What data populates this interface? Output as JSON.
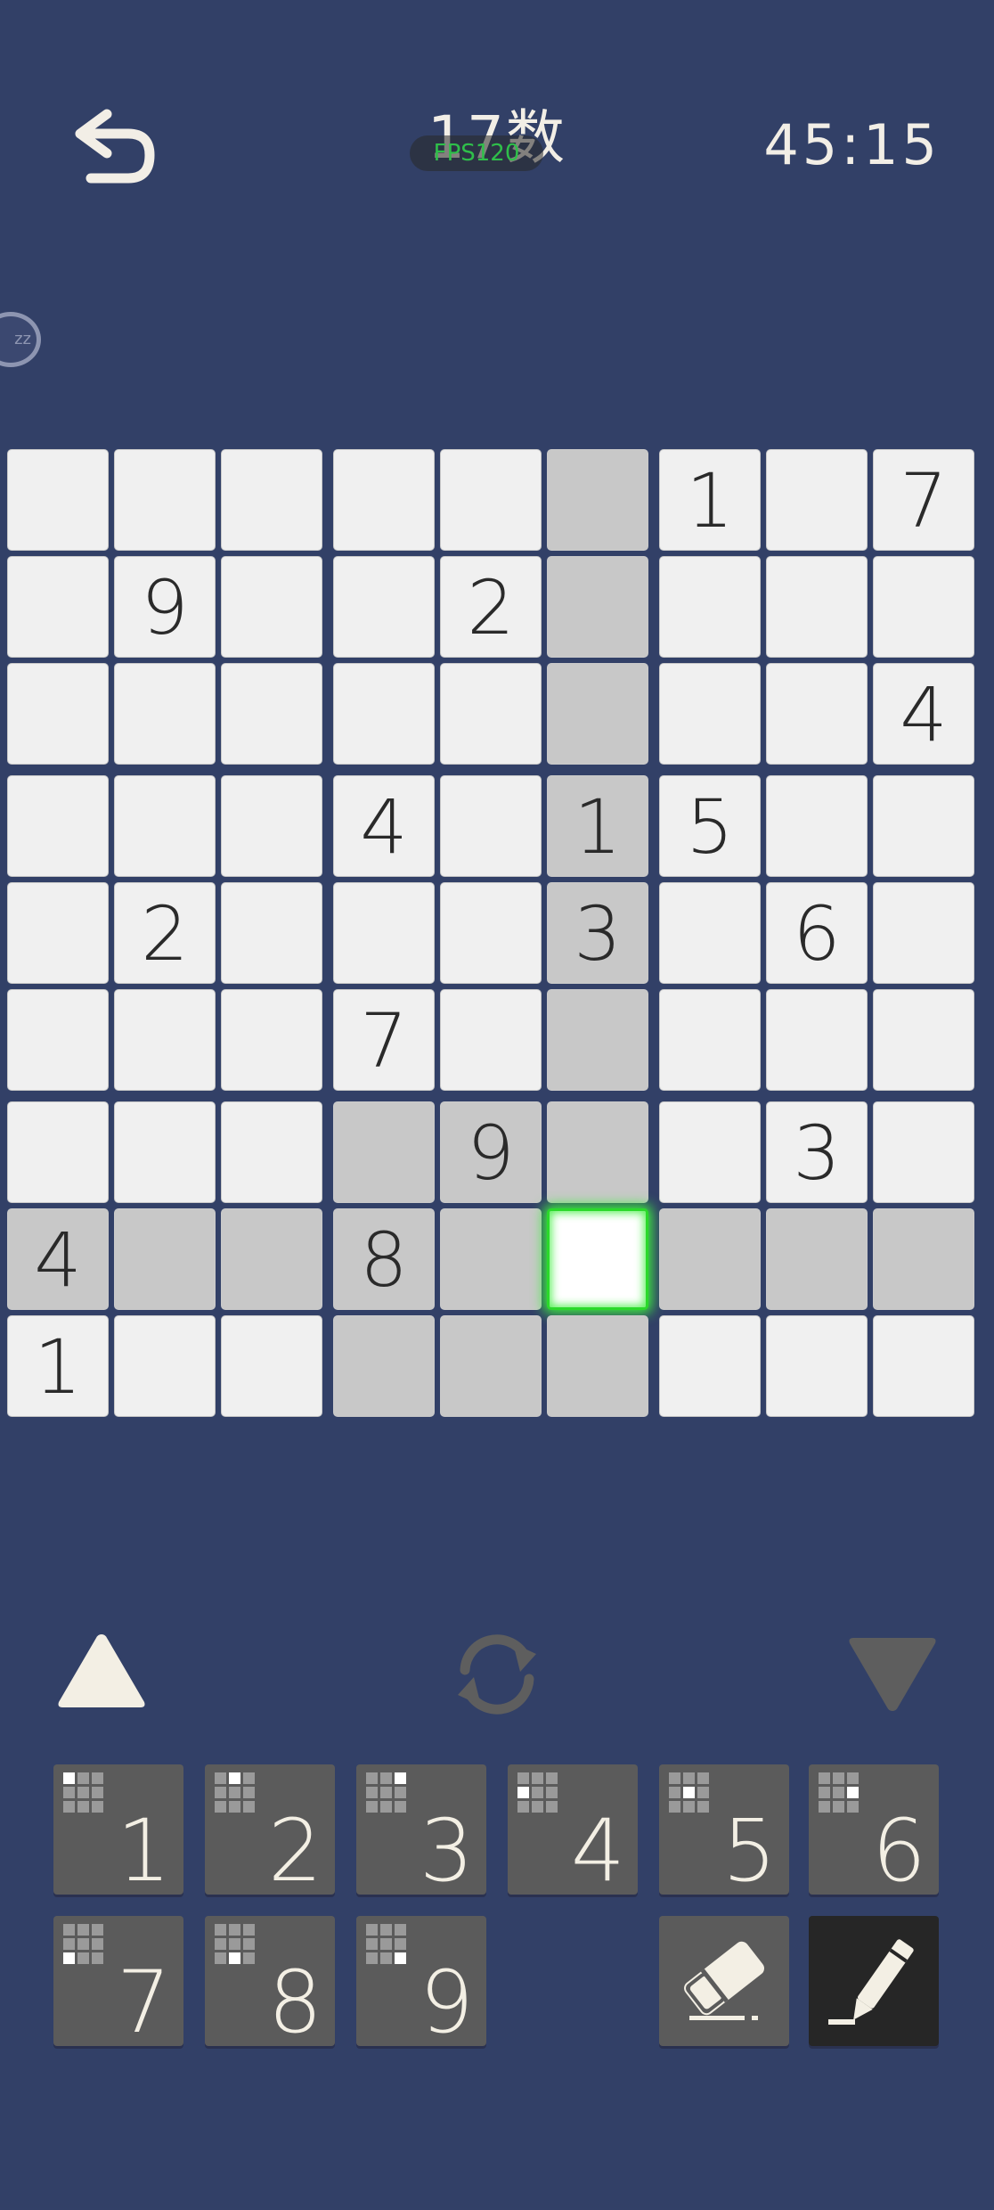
{
  "header": {
    "title": "17数",
    "fps": "FPS120",
    "timer": "45:15",
    "sleep_label": "zz"
  },
  "board": {
    "rows": [
      [
        "",
        "",
        "",
        "",
        "",
        "",
        "1",
        "",
        "7"
      ],
      [
        "",
        "9",
        "",
        "",
        "2",
        "",
        "",
        "",
        ""
      ],
      [
        "",
        "",
        "",
        "",
        "",
        "",
        "",
        "",
        "4"
      ],
      [
        "",
        "",
        "",
        "4",
        "",
        "1",
        "5",
        "",
        ""
      ],
      [
        "",
        "2",
        "",
        "",
        "",
        "3",
        "",
        "6",
        ""
      ],
      [
        "",
        "",
        "",
        "7",
        "",
        "",
        "",
        "",
        ""
      ],
      [
        "",
        "",
        "",
        "",
        "9",
        "",
        "",
        "3",
        ""
      ],
      [
        "4",
        "",
        "",
        "8",
        "",
        "",
        "",
        "",
        ""
      ],
      [
        "1",
        "",
        "",
        "",
        "",
        "",
        "",
        "",
        ""
      ]
    ],
    "selected": [
      7,
      5
    ],
    "colors": {
      "cell": "#f0f0f0",
      "highlight": "#c8c8c8",
      "selected_glow": "#2bd92b",
      "background": "#324067"
    }
  },
  "controls": {
    "up_icon": "triangle-up-icon",
    "rotate_icon": "rotate-icon",
    "down_icon": "triangle-down-icon"
  },
  "keypad": {
    "digits": [
      "1",
      "2",
      "3",
      "4",
      "5",
      "6",
      "7",
      "8",
      "9"
    ],
    "eraser_icon": "eraser-icon",
    "pencil_icon": "pencil-icon"
  }
}
